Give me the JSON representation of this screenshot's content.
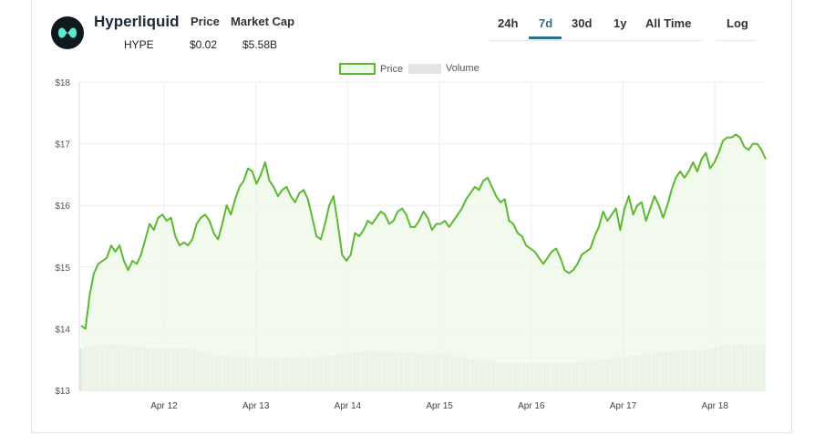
{
  "coin": {
    "name": "Hyperliquid",
    "symbol": "HYPE",
    "price_label": "Price",
    "price_value": "$0.02",
    "market_cap_label": "Market Cap",
    "market_cap_value": "$5.58B",
    "logo_icon": "hyperliquid-logo-icon",
    "logo_color": "#5ee8cf"
  },
  "controls": {
    "ranges": [
      "24h",
      "7d",
      "30d",
      "1y",
      "All Time"
    ],
    "active_range": "7d",
    "scale_label": "Log"
  },
  "chart_data": {
    "type": "area",
    "legend": [
      "Price",
      "Volume"
    ],
    "legend_placement": "top-center",
    "ylim": [
      13,
      18
    ],
    "y_ticks": [
      "$13",
      "$14",
      "$15",
      "$16",
      "$17",
      "$18"
    ],
    "x_tick_labels": [
      "Apr 12",
      "Apr 13",
      "Apr 14",
      "Apr 15",
      "Apr 16",
      "Apr 17",
      "Apr 18"
    ],
    "grid": true,
    "colors": {
      "price_line": "#5cb82e",
      "price_fill": "#eef8e8",
      "volume": "#e4e4e4",
      "grid": "#ececec"
    },
    "series": [
      {
        "name": "Price",
        "values": [
          14.05,
          14.0,
          14.55,
          14.9,
          15.05,
          15.1,
          15.15,
          15.35,
          15.25,
          15.35,
          15.1,
          14.95,
          15.1,
          15.05,
          15.2,
          15.45,
          15.7,
          15.6,
          15.8,
          15.85,
          15.75,
          15.8,
          15.5,
          15.35,
          15.4,
          15.35,
          15.45,
          15.7,
          15.8,
          15.85,
          15.75,
          15.55,
          15.45,
          15.7,
          16.0,
          15.85,
          16.1,
          16.3,
          16.4,
          16.6,
          16.55,
          16.35,
          16.5,
          16.7,
          16.4,
          16.3,
          16.15,
          16.25,
          16.3,
          16.15,
          16.05,
          16.2,
          16.25,
          16.1,
          15.8,
          15.5,
          15.45,
          15.7,
          16.0,
          16.15,
          15.7,
          15.2,
          15.1,
          15.2,
          15.55,
          15.5,
          15.6,
          15.75,
          15.7,
          15.8,
          15.9,
          15.85,
          15.7,
          15.75,
          15.9,
          15.95,
          15.85,
          15.65,
          15.65,
          15.75,
          15.9,
          15.8,
          15.6,
          15.7,
          15.7,
          15.75,
          15.65,
          15.75,
          15.85,
          15.95,
          16.1,
          16.2,
          16.3,
          16.25,
          16.4,
          16.45,
          16.3,
          16.15,
          16.05,
          16.1,
          15.75,
          15.7,
          15.55,
          15.5,
          15.35,
          15.3,
          15.25,
          15.15,
          15.05,
          15.15,
          15.25,
          15.3,
          15.15,
          14.95,
          14.9,
          14.95,
          15.05,
          15.2,
          15.25,
          15.3,
          15.5,
          15.65,
          15.9,
          15.75,
          15.85,
          15.95,
          15.6,
          15.95,
          16.15,
          15.85,
          16.0,
          16.05,
          15.75,
          15.95,
          16.15,
          16.0,
          15.8,
          16.0,
          16.25,
          16.45,
          16.55,
          16.45,
          16.55,
          16.7,
          16.55,
          16.75,
          16.85,
          16.6,
          16.7,
          16.85,
          17.05,
          17.1,
          17.1,
          17.15,
          17.1,
          16.95,
          16.9,
          17.0,
          17.0,
          16.9,
          16.75
        ]
      },
      {
        "name": "Volume",
        "values": [
          0.68,
          0.7,
          0.7,
          0.72,
          0.73,
          0.73,
          0.74,
          0.74,
          0.74,
          0.74,
          0.73,
          0.72,
          0.72,
          0.71,
          0.7,
          0.7,
          0.69,
          0.69,
          0.69,
          0.69,
          0.69,
          0.69,
          0.69,
          0.69,
          0.69,
          0.68,
          0.67,
          0.66,
          0.64,
          0.62,
          0.6,
          0.59,
          0.57,
          0.56,
          0.55,
          0.55,
          0.54,
          0.54,
          0.55,
          0.54,
          0.53,
          0.53,
          0.52,
          0.53,
          0.52,
          0.52,
          0.52,
          0.53,
          0.53,
          0.53,
          0.53,
          0.53,
          0.54,
          0.54,
          0.53,
          0.53,
          0.53,
          0.54,
          0.55,
          0.56,
          0.57,
          0.58,
          0.59,
          0.6,
          0.61,
          0.62,
          0.63,
          0.64,
          0.64,
          0.64,
          0.63,
          0.63,
          0.62,
          0.62,
          0.62,
          0.62,
          0.61,
          0.61,
          0.61,
          0.61,
          0.6,
          0.6,
          0.6,
          0.6,
          0.6,
          0.6,
          0.59,
          0.59,
          0.57,
          0.55,
          0.54,
          0.52,
          0.51,
          0.5,
          0.49,
          0.48,
          0.48,
          0.47,
          0.46,
          0.46,
          0.45,
          0.45,
          0.45,
          0.44,
          0.44,
          0.44,
          0.44,
          0.44,
          0.44,
          0.44,
          0.44,
          0.44,
          0.44,
          0.45,
          0.45,
          0.45,
          0.45,
          0.45,
          0.46,
          0.46,
          0.46,
          0.47,
          0.48,
          0.49,
          0.5,
          0.51,
          0.52,
          0.53,
          0.54,
          0.55,
          0.55,
          0.56,
          0.56,
          0.57,
          0.58,
          0.6,
          0.61,
          0.62,
          0.63,
          0.63,
          0.63,
          0.64,
          0.64,
          0.64,
          0.64,
          0.64,
          0.64,
          0.65,
          0.66,
          0.68,
          0.7,
          0.71,
          0.72,
          0.73,
          0.73,
          0.74,
          0.74,
          0.74,
          0.74,
          0.74,
          0.74,
          0.73,
          0.73
        ]
      }
    ]
  }
}
